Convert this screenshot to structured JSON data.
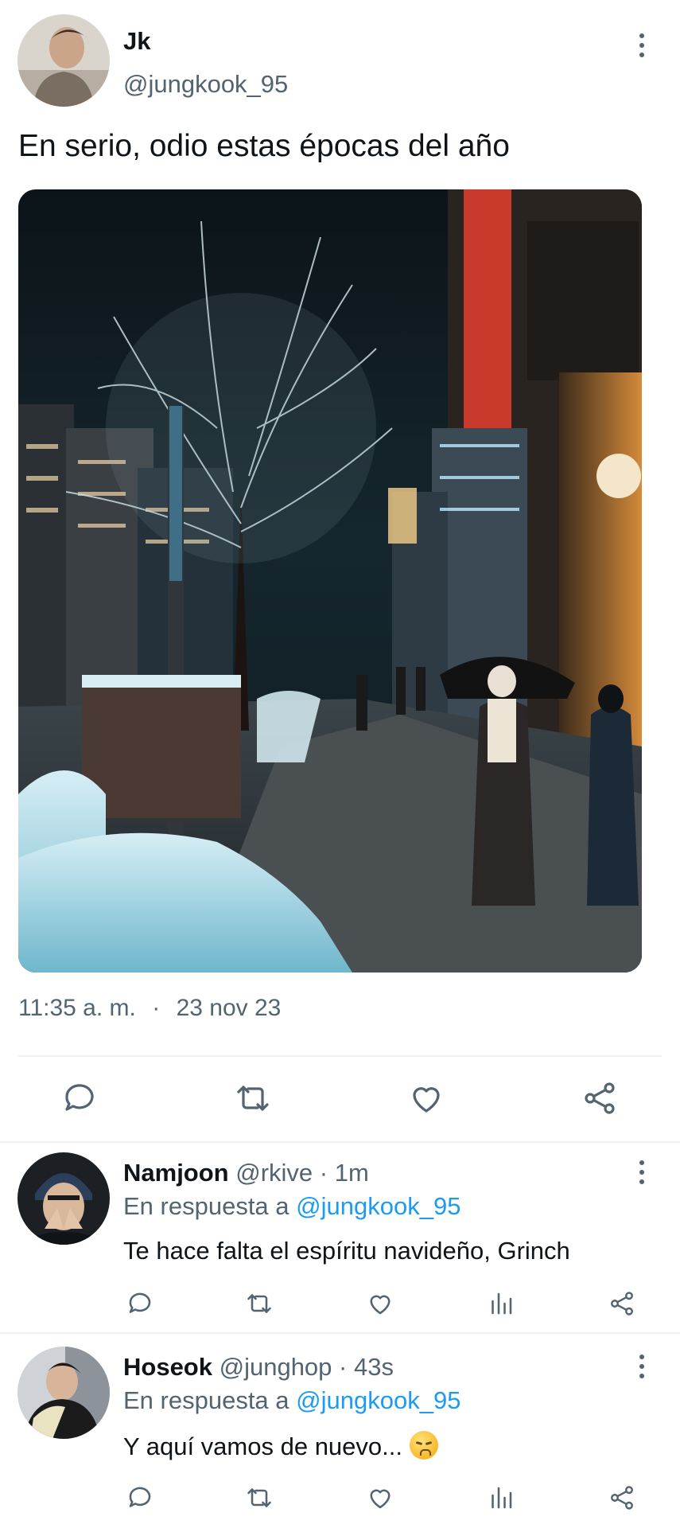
{
  "tweet": {
    "author_name": "Jk",
    "author_handle": "@jungkook_95",
    "text": "En serio, odio estas épocas del año",
    "time": "11:35 a. m.",
    "separator": "·",
    "date": "23 nov 23",
    "actions": [
      "reply-icon",
      "retweet-icon",
      "like-icon",
      "share-icon"
    ]
  },
  "replies": [
    {
      "name": "Namjoon",
      "handle": "@rkive",
      "time_sep": "·",
      "time": "1m",
      "reply_prefix": "En respuesta a",
      "reply_to": "@jungkook_95",
      "text": "Te hace falta el espíritu navideño, Grinch"
    },
    {
      "name": "Hoseok",
      "handle": "@junghop",
      "time_sep": "·",
      "time": "43s",
      "reply_prefix": "En respuesta a",
      "reply_to": "@jungkook_95",
      "text": "Y aquí vamos de nuevo...",
      "emoji": "worried-face-emoji"
    }
  ],
  "colors": {
    "text": "#0f1419",
    "muted": "#536471",
    "link": "#1d9bf0",
    "divider": "#eff3f4"
  }
}
